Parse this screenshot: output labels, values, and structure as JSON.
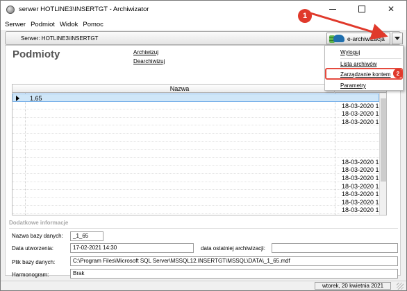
{
  "window": {
    "title": "serwer HOTLINE3\\INSERTGT - Archiwizator",
    "minimize": "—",
    "maximize": "☐",
    "close": "✕"
  },
  "menu": [
    "Serwer",
    "Podmiot",
    "Widok",
    "Pomoc"
  ],
  "server_bar": {
    "label": "Serwer:  HOTLINE3\\INSERTGT",
    "earchive_label": "e-archiwizacja"
  },
  "dropdown_menu": [
    "Wyloguj",
    "Lista archiwów",
    "Zarządzanie kontem",
    "Parametry"
  ],
  "annotations": {
    "marker1": "1",
    "marker2": "2",
    "accent": "#e0392b"
  },
  "main": {
    "title": "Podmioty",
    "archive_link": "Archiwizuj",
    "dearchive_link": "Dearchiwizuj",
    "grid": {
      "header_name": "Nazwa",
      "rows": [
        {
          "name": "1.65",
          "date": ""
        },
        {
          "name": "",
          "date": "18-03-2020 1"
        },
        {
          "name": "",
          "date": "18-03-2020 1"
        },
        {
          "name": "",
          "date": "18-03-2020 1"
        },
        {
          "name": "",
          "date": ""
        },
        {
          "name": "",
          "date": ""
        },
        {
          "name": "",
          "date": ""
        },
        {
          "name": "",
          "date": ""
        },
        {
          "name": "",
          "date": "18-03-2020 1"
        },
        {
          "name": "",
          "date": "18-03-2020 1"
        },
        {
          "name": "",
          "date": "18-03-2020 1"
        },
        {
          "name": "",
          "date": "18-03-2020 1"
        },
        {
          "name": "",
          "date": "18-03-2020 1"
        },
        {
          "name": "",
          "date": "18-03-2020 1"
        },
        {
          "name": "",
          "date": "18-03-2020 1"
        }
      ]
    }
  },
  "details": {
    "section_title": "Dodatkowe informacje",
    "db_name_label": "Nazwa bazy danych:",
    "db_name_value": "_1_65",
    "created_label": "Data utworzenia:",
    "created_value": "17-02-2021 14:30",
    "last_archive_label": "data ostatniej archiwizacji:",
    "last_archive_value": "",
    "db_file_label": "Plik bazy danych:",
    "db_file_value": "C:\\Program Files\\Microsoft SQL Server\\MSSQL12.INSERTGT\\MSSQL\\DATA\\_1_65.mdf",
    "schedule_label": "Harmonogram:",
    "schedule_value": "Brak"
  },
  "status": {
    "date": "wtorek, 20 kwietnia 2021"
  }
}
